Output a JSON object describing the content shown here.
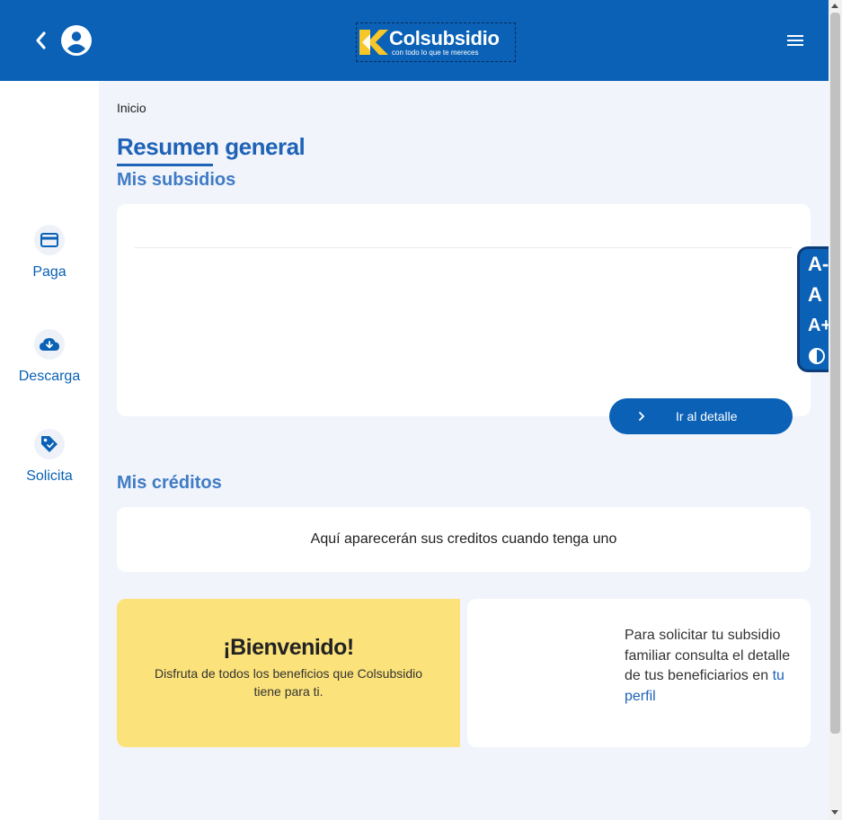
{
  "header": {
    "logo": {
      "name": "Colsubsidio",
      "tagline": "con todo lo que te mereces"
    },
    "icons": {
      "back": "chevron-left-icon",
      "user": "user-circle-icon",
      "menu": "hamburger-menu-icon"
    }
  },
  "sidebar": {
    "items": [
      {
        "label": "Paga",
        "icon": "credit-card-icon"
      },
      {
        "label": "Descarga",
        "icon": "cloud-download-icon"
      },
      {
        "label": "Solicita",
        "icon": "tag-icon"
      }
    ]
  },
  "breadcrumb": "Inicio",
  "page_title": "Resumen general",
  "subsidios": {
    "title": "Mis subsidios",
    "detail_button": "Ir al detalle"
  },
  "creditos": {
    "title": "Mis créditos",
    "empty_message": "Aquí aparecerán sus creditos cuando tenga uno"
  },
  "welcome": {
    "title": "¡Bienvenido!",
    "text": "Disfruta de todos los beneficios que Colsubsidio tiene para ti."
  },
  "info": {
    "text": "Para solicitar tu subsidio familiar consulta el detalle de tus beneficiarios en",
    "link": "tu perfil"
  },
  "accessibility": {
    "decrease_text": "A-",
    "normal_text": "A",
    "increase_text": "A+",
    "contrast_icon": "contrast-icon"
  },
  "colors": {
    "brand_blue": "#0a61b6",
    "title_blue": "#1f63b7",
    "logo_yellow": "#f7c72a",
    "welcome_yellow": "#fbe27a",
    "page_bg": "#f1f4fa"
  }
}
